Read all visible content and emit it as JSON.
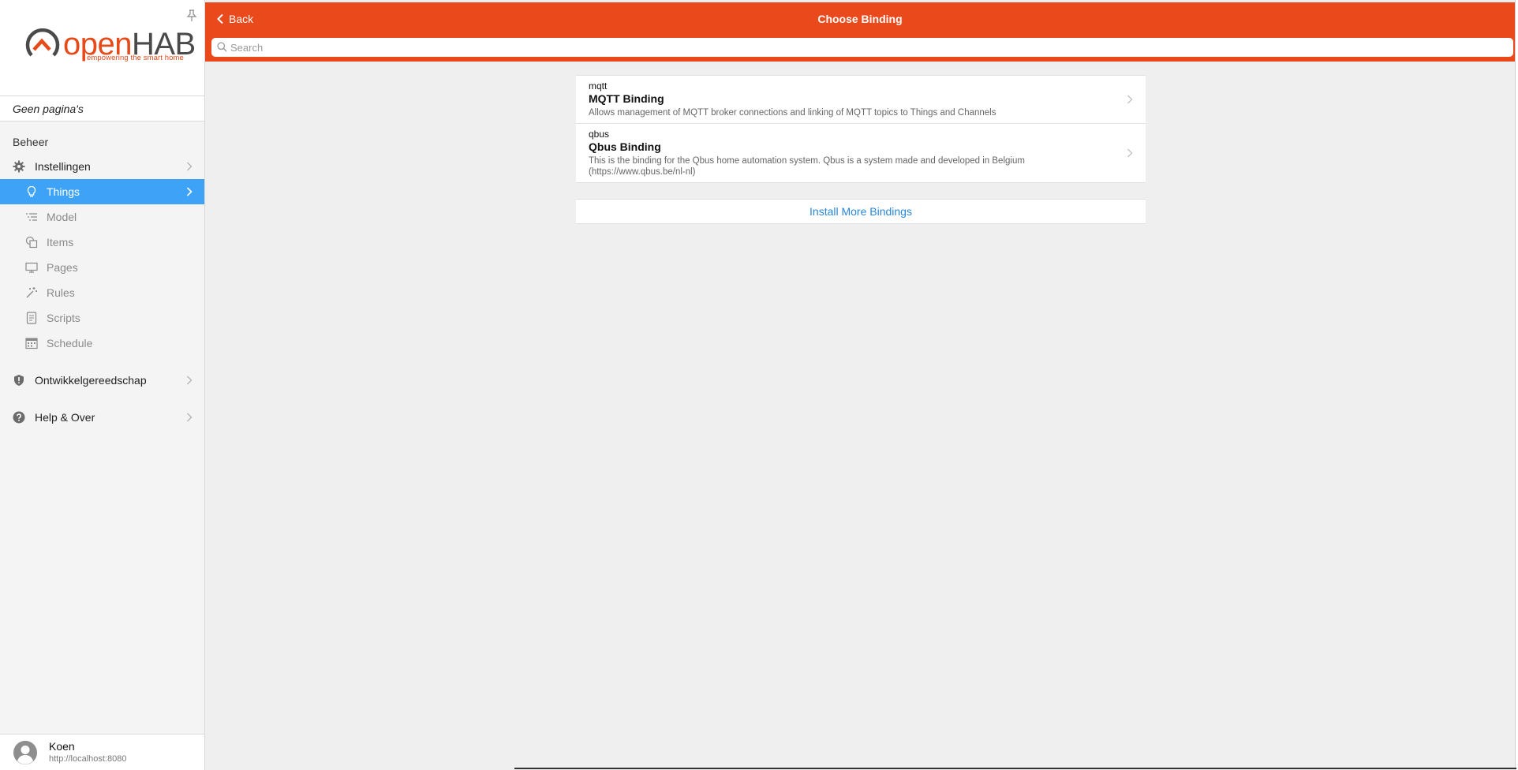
{
  "logo": {
    "text_open": "open",
    "text_hab": "HAB",
    "tagline": "empowering the smart home"
  },
  "sidebar": {
    "no_pages": "Geen pagina's",
    "section": "Beheer",
    "items": [
      {
        "label": "Instellingen",
        "icon": "gear-icon"
      },
      {
        "label": "Things",
        "icon": "lightbulb-icon",
        "active": true
      },
      {
        "label": "Model",
        "icon": "list-icon"
      },
      {
        "label": "Items",
        "icon": "items-icon"
      },
      {
        "label": "Pages",
        "icon": "monitor-icon"
      },
      {
        "label": "Rules",
        "icon": "magic-wand-icon"
      },
      {
        "label": "Scripts",
        "icon": "document-icon"
      },
      {
        "label": "Schedule",
        "icon": "calendar-icon"
      },
      {
        "label": "Ontwikkelgereedschap",
        "icon": "shield-icon"
      },
      {
        "label": "Help & Over",
        "icon": "question-icon"
      }
    ],
    "user": {
      "name": "Koen",
      "url": "http://localhost:8080"
    }
  },
  "navbar": {
    "back_label": "Back",
    "title": "Choose Binding",
    "search_placeholder": "Search"
  },
  "bindings": [
    {
      "id": "mqtt",
      "title": "MQTT Binding",
      "description": "Allows management of MQTT broker connections and linking of MQTT topics to Things and Channels"
    },
    {
      "id": "qbus",
      "title": "Qbus Binding",
      "description": "This is the binding for the Qbus home automation system. Qbus is a system made and developed in Belgium (https://www.qbus.be/nl-nl)"
    }
  ],
  "install_more": "Install More Bindings",
  "colors": {
    "accent": "#e9491b",
    "active": "#3ea3f7",
    "link": "#2a86d6"
  }
}
